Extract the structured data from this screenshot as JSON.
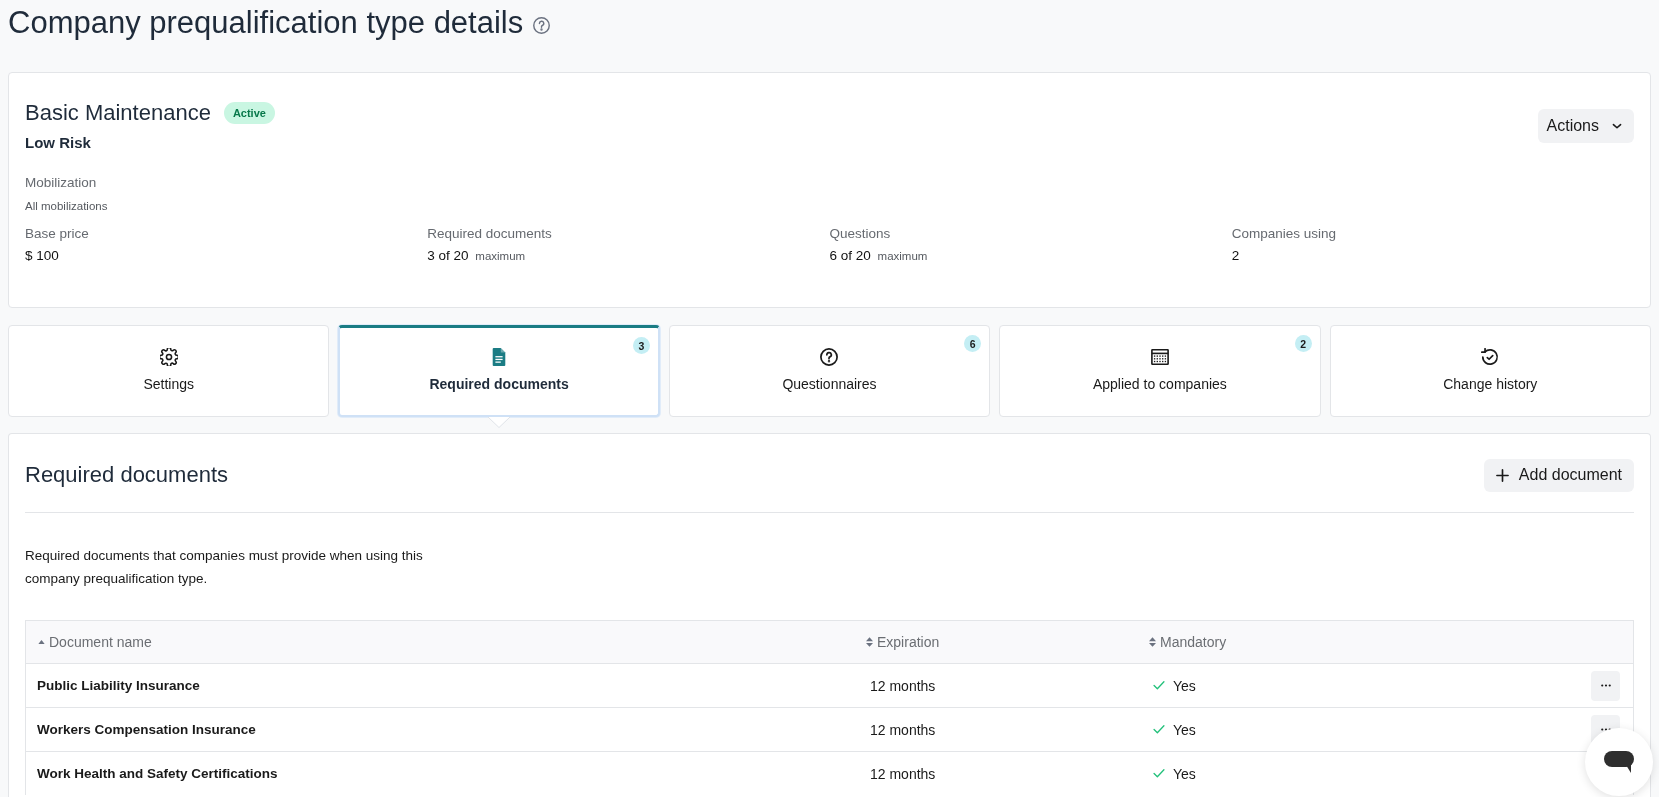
{
  "page": {
    "title": "Company prequalification type details"
  },
  "summary": {
    "name": "Basic Maintenance",
    "status": {
      "label": "Active",
      "kind": "active"
    },
    "risk": "Low Risk",
    "actions_button": "Actions",
    "mobilization": {
      "label": "Mobilization",
      "value": "All mobilizations"
    },
    "stats": [
      {
        "label": "Base price",
        "value": "$ 100"
      },
      {
        "label": "Required documents",
        "value": "3 of 20",
        "note": "maximum"
      },
      {
        "label": "Questions",
        "value": "6 of 20",
        "note": "maximum"
      },
      {
        "label": "Companies using",
        "value": "2"
      }
    ]
  },
  "tabs": [
    {
      "label": "Settings",
      "selected": false
    },
    {
      "label": "Required documents",
      "badge": "3",
      "selected": true
    },
    {
      "label": "Questionnaires",
      "badge": "6",
      "selected": false
    },
    {
      "label": "Applied to companies",
      "badge": "2",
      "selected": false
    },
    {
      "label": "Change history",
      "selected": false
    }
  ],
  "section": {
    "title": "Required documents",
    "add_button": "Add document",
    "description": "Required documents that companies must provide when using this company prequalification type."
  },
  "table": {
    "columns": [
      {
        "label": "Document name",
        "sorted": true
      },
      {
        "label": "Expiration",
        "sorted": false
      },
      {
        "label": "Mandatory",
        "sorted": false
      }
    ],
    "rows": [
      {
        "name": "Public Liability Insurance",
        "expiration": "12 months",
        "mandatory": {
          "value": true,
          "label": "Yes"
        },
        "menu": true
      },
      {
        "name": "Workers Compensation Insurance",
        "expiration": "12 months",
        "mandatory": {
          "value": true,
          "label": "Yes"
        },
        "menu": true
      },
      {
        "name": "Work Health and Safety Certifications",
        "expiration": "12 months",
        "mandatory": {
          "value": true,
          "label": "Yes"
        },
        "menu": false
      }
    ]
  }
}
